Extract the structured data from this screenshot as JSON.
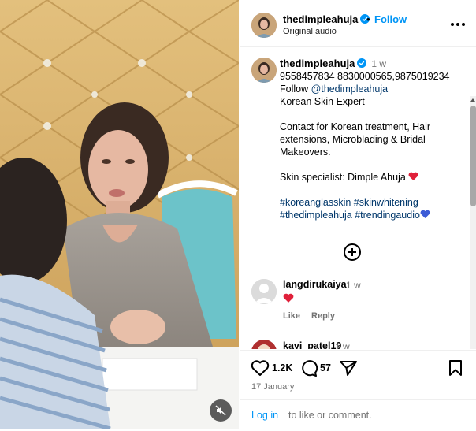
{
  "header": {
    "username": "thedimpleahuja",
    "follow_label": "Follow",
    "audio": "Original audio",
    "separator": "•"
  },
  "caption": {
    "username": "thedimpleahuja",
    "time": "1 w",
    "phones": "9558457834 8830000565,9875019234",
    "follow_prefix": "Follow ",
    "follow_handle": "@thedimpleahuja",
    "line3": "Korean Skin Expert",
    "contact": "Contact for Korean treatment, Hair extensions, Microblading & Bridal Makeovers.",
    "specialist": "Skin specialist: Dimple Ahuja",
    "hashtags_1": "#koreanglasskin #skinwhitening",
    "hashtags_2": "#thedimpleahuja #trendingaudio"
  },
  "comments": [
    {
      "username": "langdirukaiya",
      "time": "1 w",
      "like_label": "Like",
      "reply_label": "Reply"
    },
    {
      "username": "kavi_patel19",
      "time": "1 w"
    }
  ],
  "actions": {
    "likes": "1.2K",
    "comments": "57",
    "date": "17 January"
  },
  "footer": {
    "login_link": "Log in",
    "login_rest": "to like or comment."
  },
  "colors": {
    "accent": "#0095f6",
    "link": "#00376b",
    "muted": "#737373",
    "heart": "#ed4956",
    "wall": "#d9b56b"
  }
}
